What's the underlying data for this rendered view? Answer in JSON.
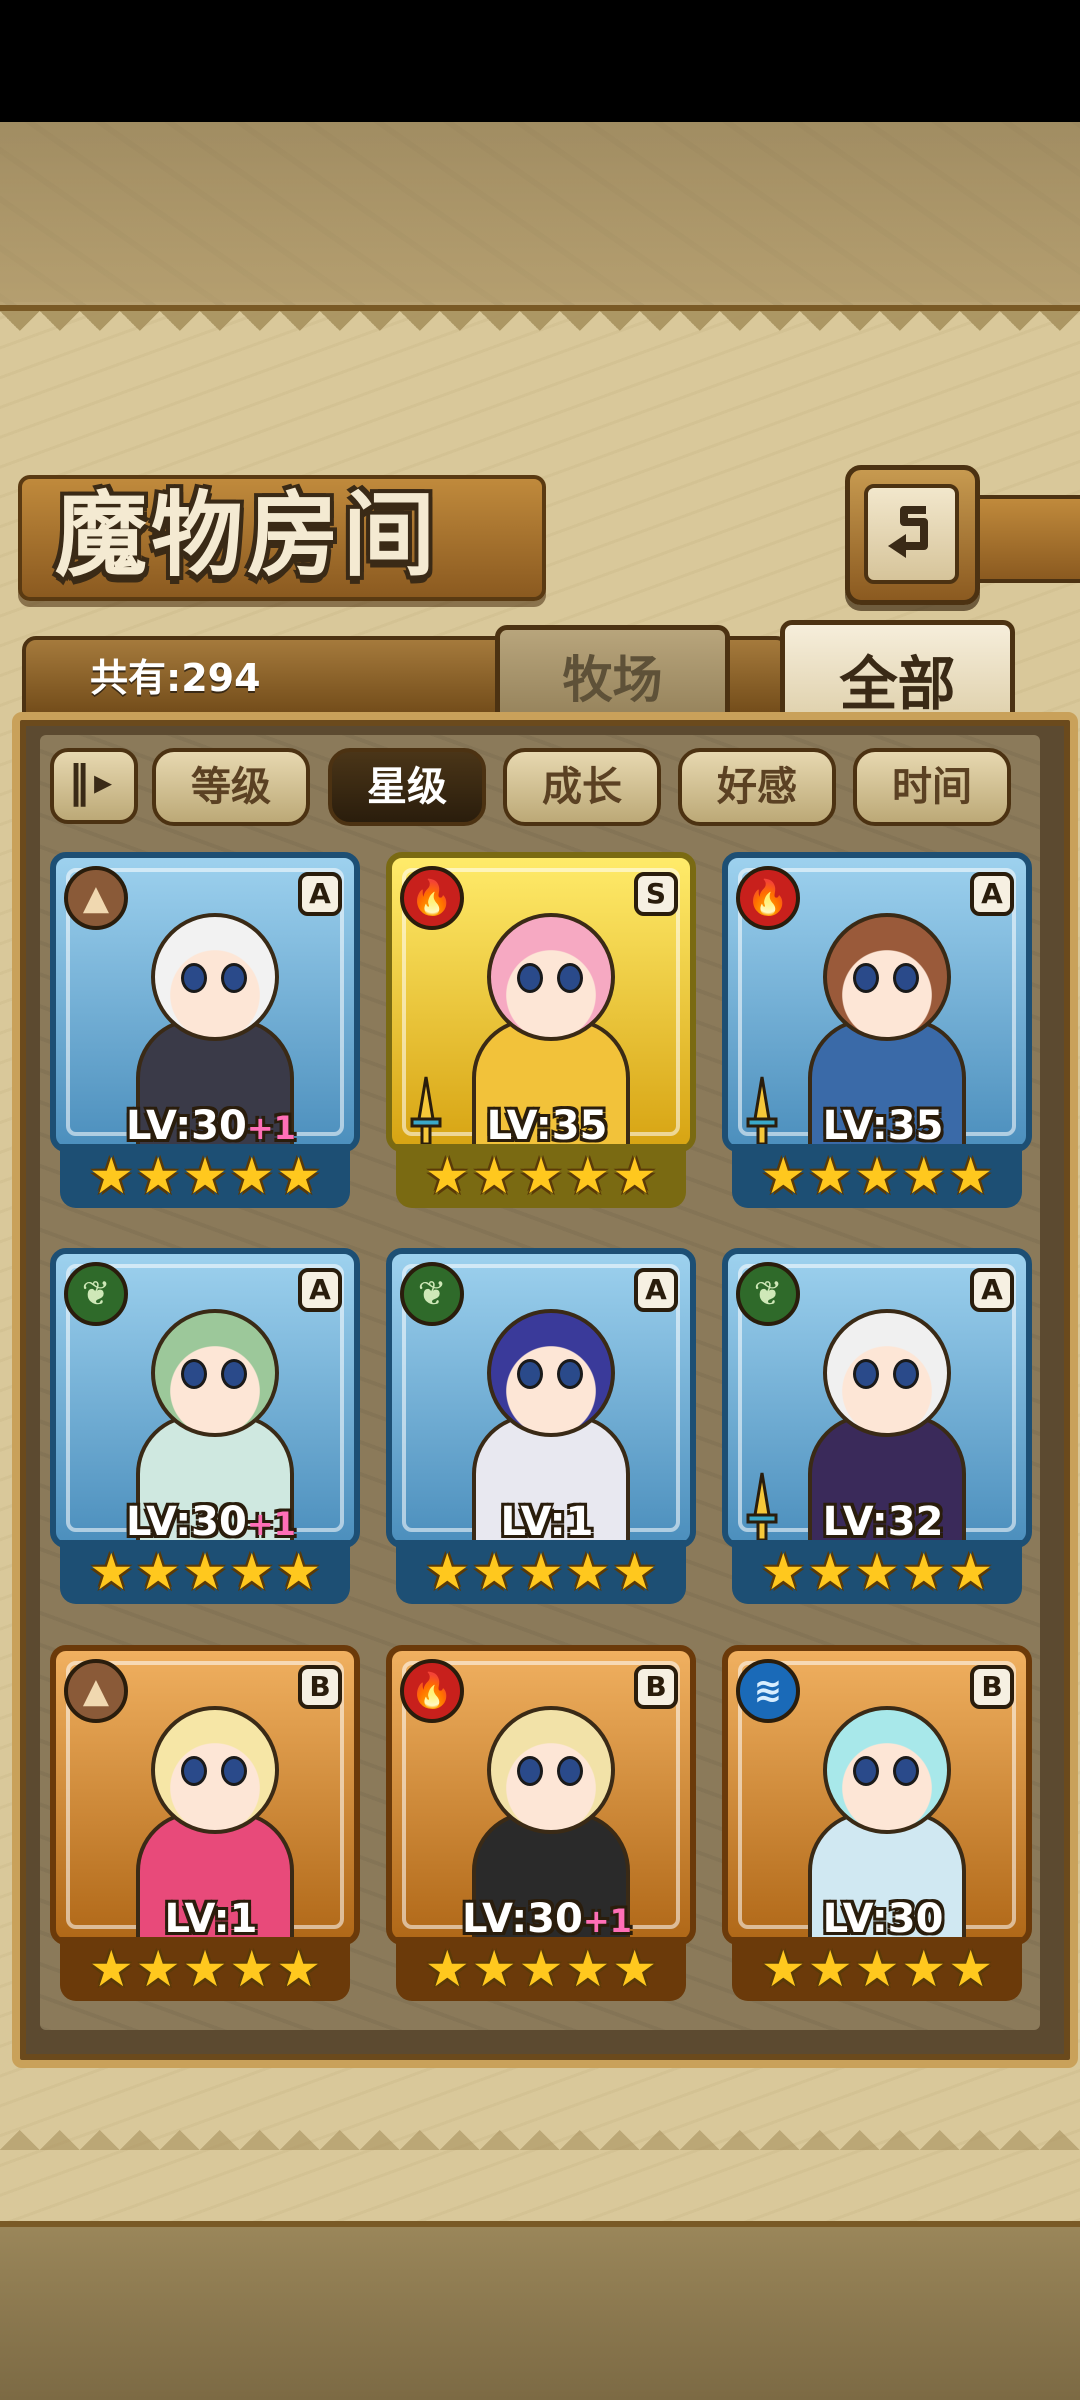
{
  "header": {
    "title": "魔物房间",
    "back_icon": "return-arrow-icon"
  },
  "summary": {
    "total_label": "共有:294"
  },
  "tabs": [
    {
      "label": "牧场",
      "active": false
    },
    {
      "label": "全部",
      "active": true
    }
  ],
  "sort": {
    "toggle_icon": "sort-order-icon",
    "options": [
      {
        "label": "等级",
        "active": false
      },
      {
        "label": "星级",
        "active": true
      },
      {
        "label": "成长",
        "active": false
      },
      {
        "label": "好感",
        "active": false
      },
      {
        "label": "时间",
        "active": false
      }
    ]
  },
  "monsters": [
    {
      "element": "earth",
      "grade": "A",
      "level": "LV:30",
      "bonus": "+1",
      "stars": 5,
      "frame": "blue",
      "has_weapon": false
    },
    {
      "element": "fire",
      "grade": "S",
      "level": "LV:35",
      "bonus": "",
      "stars": 5,
      "frame": "gold",
      "has_weapon": true
    },
    {
      "element": "fire",
      "grade": "A",
      "level": "LV:35",
      "bonus": "",
      "stars": 5,
      "frame": "blue",
      "has_weapon": true
    },
    {
      "element": "wood",
      "grade": "A",
      "level": "LV:30",
      "bonus": "+1",
      "stars": 5,
      "frame": "blue",
      "has_weapon": false
    },
    {
      "element": "wood",
      "grade": "A",
      "level": "LV:1",
      "bonus": "",
      "stars": 5,
      "frame": "blue",
      "has_weapon": false
    },
    {
      "element": "wood",
      "grade": "A",
      "level": "LV:32",
      "bonus": "",
      "stars": 5,
      "frame": "blue",
      "has_weapon": true
    },
    {
      "element": "earth",
      "grade": "B",
      "level": "LV:1",
      "bonus": "",
      "stars": 5,
      "frame": "bronze",
      "has_weapon": false
    },
    {
      "element": "fire",
      "grade": "B",
      "level": "LV:30",
      "bonus": "+1",
      "stars": 5,
      "frame": "bronze",
      "has_weapon": false
    },
    {
      "element": "water",
      "grade": "B",
      "level": "LV:30",
      "bonus": "",
      "stars": 5,
      "frame": "bronze",
      "has_weapon": false
    }
  ],
  "colors": {
    "hair": [
      "#f2f2f2",
      "#f6a9c2",
      "#9a5a3a",
      "#9cc89a",
      "#3a3a9a",
      "#f0f0f0",
      "#f6e6a6",
      "#f2e2a8",
      "#a8e8ea"
    ],
    "outfit": [
      "#3a3a48",
      "#f2c23a",
      "#3a6aa8",
      "#cfe8e0",
      "#e8e8f0",
      "#3a2a5a",
      "#e84a7a",
      "#2a2a2a",
      "#d0e8f2"
    ]
  }
}
